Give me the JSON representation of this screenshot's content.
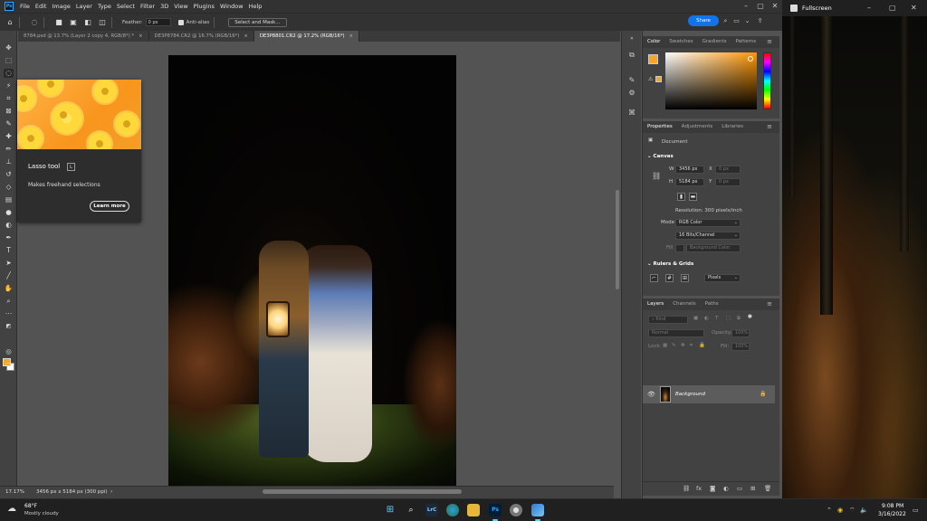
{
  "app": {
    "logo": "Ps",
    "menu": [
      "File",
      "Edit",
      "Image",
      "Layer",
      "Type",
      "Select",
      "Filter",
      "3D",
      "View",
      "Plugins",
      "Window",
      "Help"
    ],
    "share_label": "Share"
  },
  "options_bar": {
    "feather_label": "Feather:",
    "feather_value": "0 px",
    "antialias_label": "Anti-alias",
    "select_mask_label": "Select and Mask..."
  },
  "tabs": [
    {
      "label": "8784.psd @ 13.7% (Layer 2 copy 4, RGB/8*) *"
    },
    {
      "label": "DE3P8784.CR2 @ 16.7% (RGB/16*)"
    },
    {
      "label": "DE3P8801.CR2 @ 17.2% (RGB/16*)"
    }
  ],
  "tooltip": {
    "title": "Lasso tool",
    "shortcut": "L",
    "description": "Makes freehand selections",
    "learn_more": "Learn more"
  },
  "status": {
    "zoom": "17.17%",
    "doc_info": "3456 px x 5184 px (300 ppi)"
  },
  "color_panel": {
    "tabs": [
      "Color",
      "Swatches",
      "Gradients",
      "Patterns"
    ],
    "foreground": "#f5a623",
    "background": "#ffffff"
  },
  "properties": {
    "tabs": [
      "Properties",
      "Adjustments",
      "Libraries"
    ],
    "doc_label": "Document",
    "canvas_title": "Canvas",
    "w_label": "W",
    "w_value": "3456 px",
    "x_label": "X",
    "x_value": "0 px",
    "h_label": "H",
    "h_value": "5184 px",
    "y_label": "Y",
    "y_value": "0 px",
    "resolution": "Resolution: 300 pixels/inch",
    "mode_label": "Mode",
    "mode_value": "RGB Color",
    "depth_value": "16 Bits/Channel",
    "fill_label": "Fill",
    "fill_value": "Background Color",
    "rulers_title": "Rulers & Grids",
    "units_value": "Pixels"
  },
  "layers": {
    "tabs": [
      "Layers",
      "Channels",
      "Paths"
    ],
    "kind_placeholder": "Kind",
    "blend_mode": "Normal",
    "opacity_label": "Opacity:",
    "opacity_value": "100%",
    "lock_label": "Lock:",
    "fill_label": "Fill:",
    "fill_value": "100%",
    "layer_name": "Background"
  },
  "fullscreen_window": {
    "title": "Fullscreen"
  },
  "taskbar": {
    "temperature": "68°F",
    "condition": "Mostly cloudy",
    "time": "9:08 PM",
    "date": "3/16/2022"
  }
}
